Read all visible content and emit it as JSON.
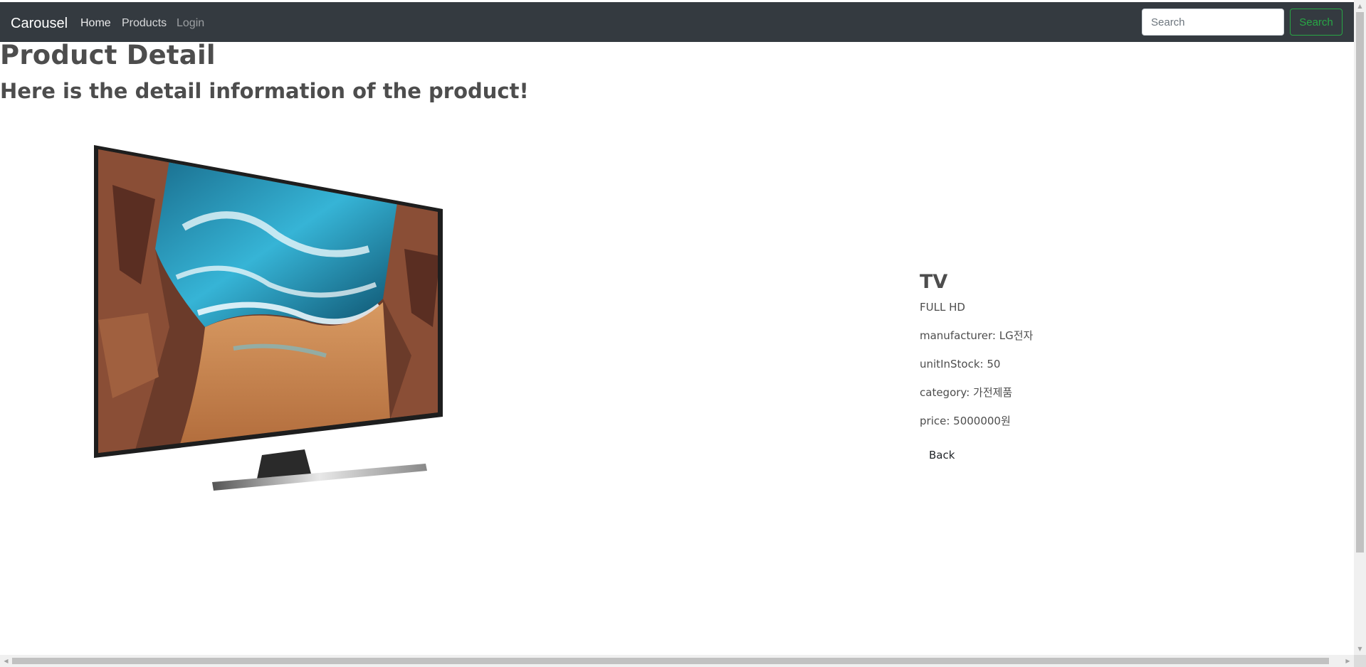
{
  "navbar": {
    "brand": "Carousel",
    "links": [
      {
        "label": "Home"
      },
      {
        "label": "Products"
      },
      {
        "label": "Login"
      }
    ],
    "search": {
      "placeholder": "Search",
      "value": "",
      "button_label": "Search",
      "button_color": "#28a745"
    },
    "background_color": "#343a40"
  },
  "page": {
    "title": "Product Detail",
    "subtitle": "Here is the detail information of the product!"
  },
  "product": {
    "image_alt": "TV",
    "name": "TV",
    "description": "FULL HD",
    "manufacturer": "manufacturer: LG전자",
    "unitInStock": "unitInStock: 50",
    "category": "category: 가전제품",
    "price": "price: 5000000원",
    "back_label": "Back"
  },
  "scrollbars": {
    "up_arrow": "▲",
    "down_arrow": "▼",
    "left_arrow": "◀",
    "right_arrow": "▶"
  }
}
